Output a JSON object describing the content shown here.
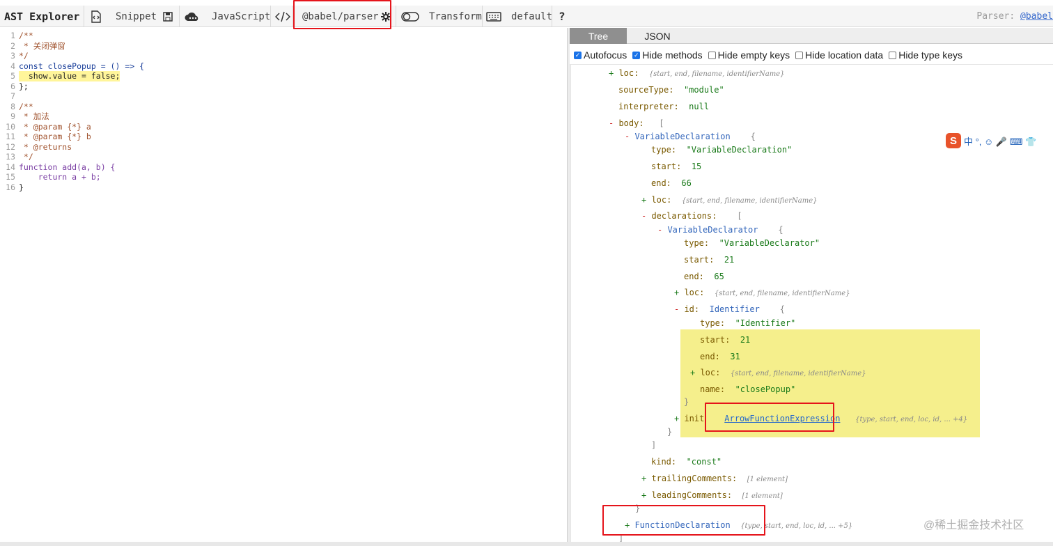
{
  "toolbar": {
    "brand": "AST Explorer",
    "snippet": "Snippet",
    "language": "JavaScript",
    "parser": "@babel/parser",
    "transform": "Transform",
    "keymap": "default",
    "help": "?",
    "parser_label": "Parser:",
    "parser_link": "@babel"
  },
  "editor": {
    "lines": [
      {
        "n": "1",
        "text": "/**"
      },
      {
        "n": "2",
        "text": " * 关闭弹窗"
      },
      {
        "n": "3",
        "text": "*/"
      },
      {
        "n": "4",
        "text": "const closePopup = () => {"
      },
      {
        "n": "5",
        "text": "  show.value = false;"
      },
      {
        "n": "6",
        "text": "};"
      },
      {
        "n": "7",
        "text": ""
      },
      {
        "n": "8",
        "text": "/**"
      },
      {
        "n": "9",
        "text": " * 加法"
      },
      {
        "n": "10",
        "text": " * @param {*} a"
      },
      {
        "n": "11",
        "text": " * @param {*} b"
      },
      {
        "n": "12",
        "text": " * @returns"
      },
      {
        "n": "13",
        "text": " */"
      },
      {
        "n": "14",
        "text": "function add(a, b) {"
      },
      {
        "n": "15",
        "text": "    return a + b;"
      },
      {
        "n": "16",
        "text": "}"
      }
    ]
  },
  "panel": {
    "tabs": [
      "Tree",
      "JSON"
    ],
    "options": [
      {
        "label": "Autofocus",
        "checked": true
      },
      {
        "label": "Hide methods",
        "checked": true
      },
      {
        "label": "Hide empty keys",
        "checked": false
      },
      {
        "label": "Hide location data",
        "checked": false
      },
      {
        "label": "Hide type keys",
        "checked": false
      }
    ]
  },
  "tree": {
    "loc_meta": "{start, end, filename, identifierName}",
    "sourceType_key": "sourceType:",
    "sourceType_val": "\"module\"",
    "interpreter_key": "interpreter:",
    "interpreter_val": "null",
    "body_key": "body:",
    "vd_name": "VariableDeclaration",
    "vd_type_val": "\"VariableDeclaration\"",
    "vd_start": "15",
    "vd_end": "66",
    "declarations_key": "declarations:",
    "vdr_name": "VariableDeclarator",
    "vdr_type_val": "\"VariableDeclarator\"",
    "vdr_start": "21",
    "vdr_end": "65",
    "id_key": "id:",
    "id_name": "Identifier",
    "id_type_val": "\"Identifier\"",
    "id_start": "21",
    "id_end": "31",
    "id_name_key": "name:",
    "id_name_val": "\"closePopup\"",
    "init_key": "init",
    "init_link": "ArrowFunctionExpression",
    "init_meta": "{type, start, end, loc, id, ... +4}",
    "kind_key": "kind:",
    "kind_val": "\"const\"",
    "trailing_key": "trailingComments:",
    "trailing_meta": "[1 element]",
    "leading_key": "leadingComments:",
    "leading_meta": "[1 element]",
    "fd_name": "FunctionDeclaration",
    "fd_meta": "{type, start, end, loc, id, ... +5}",
    "k_type": "type:",
    "k_start": "start:",
    "k_end": "end:",
    "k_loc": "loc:"
  },
  "ime": {
    "chars": "中 °, ☺ 🎤 ⌨ 👕"
  },
  "watermark": "@稀土掘金技术社区"
}
